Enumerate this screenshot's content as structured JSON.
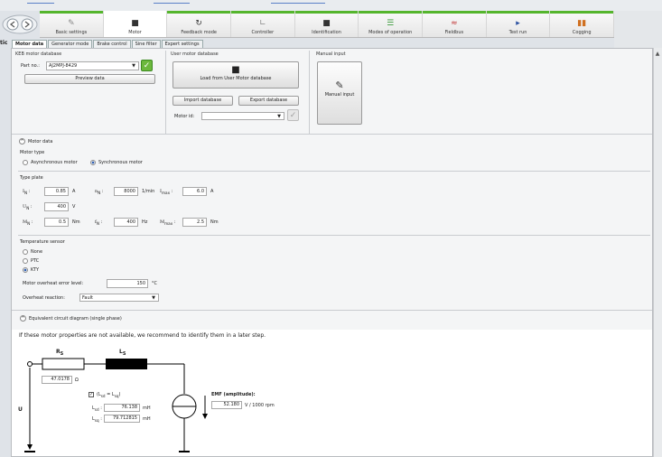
{
  "ribbon": {
    "tabs": [
      {
        "label": "Basic settings",
        "icon": "wrench-icon",
        "active": false
      },
      {
        "label": "Motor",
        "icon": "motor-icon",
        "active": true
      },
      {
        "label": "Feedback mode",
        "icon": "feedback-icon",
        "active": false
      },
      {
        "label": "Controller",
        "icon": "controller-icon",
        "active": false
      },
      {
        "label": "Identification",
        "icon": "identification-icon",
        "active": false
      },
      {
        "label": "Modes of operation",
        "icon": "modes-icon",
        "active": false
      },
      {
        "label": "Fieldbus",
        "icon": "fieldbus-icon",
        "active": false
      },
      {
        "label": "Test run",
        "icon": "play-icon",
        "active": false
      },
      {
        "label": "Cogging",
        "icon": "bar-chart-icon",
        "active": false
      }
    ],
    "accent": "#55b52d"
  },
  "subtabs": [
    {
      "label": "Motor data",
      "active": true
    },
    {
      "label": "Generator mode",
      "active": false
    },
    {
      "label": "Brake control",
      "active": false
    },
    {
      "label": "Sine filter",
      "active": false
    },
    {
      "label": "Expert settings",
      "active": false
    }
  ],
  "side_label": "tic",
  "keb_db": {
    "title": "KEB motor database",
    "partno_label": "Part no.:",
    "partno_value": "AJ2MPJ-8429",
    "preview_label": "Preview data"
  },
  "user_db": {
    "title": "User motor database",
    "load_label": "Load from User Motor database",
    "import_label": "Import database",
    "export_label": "Export database",
    "motorid_label": "Motor id:"
  },
  "manual": {
    "title": "Manual input",
    "button_label": "Manual input"
  },
  "motor_data": {
    "header": "Motor data",
    "type_title": "Motor type",
    "async_label": "Asynchronous motor",
    "sync_label": "Synchronous motor"
  },
  "type_plate": {
    "title": "Type plate",
    "in_label": "I",
    "in_sub": "N",
    "in_value": "0.85",
    "in_unit": "A",
    "nn_label": "n",
    "nn_sub": "N",
    "nn_value": "8000",
    "nn_unit": "1/min",
    "imax_label": "I",
    "imax_sub": "max",
    "imax_value": "6.0",
    "imax_unit": "A",
    "un_label": "U",
    "un_sub": "N",
    "un_value": "400",
    "un_unit": "V",
    "mn_label": "M",
    "mn_sub": "N",
    "mn_value": "0.5",
    "mn_unit": "Nm",
    "fn_label": "f",
    "fn_sub": "N",
    "fn_value": "400",
    "fn_unit": "Hz",
    "mmax_label": "M",
    "mmax_sub": "max",
    "mmax_value": "2.5",
    "mmax_unit": "Nm"
  },
  "temp_sensor": {
    "title": "Temperature sensor",
    "options": [
      "None",
      "PTC",
      "KTY"
    ],
    "selected": "KTY",
    "overheat_error_label": "Motor overheat error level:",
    "overheat_error_value": "150",
    "overheat_error_unit": "°C",
    "overheat_reaction_label": "Overheat reaction:",
    "overheat_reaction_value": "Fault"
  },
  "ecd": {
    "header": "Equivalent circuit diagram (single phase)",
    "note": "If these motor properties are not available, we recommend to identify them in a later step.",
    "rs_label": "R",
    "rs_sub": "S",
    "ls_label": "L",
    "ls_sub": "S",
    "rs_value": "47.0178",
    "rs_unit": "Ω",
    "lsq_check_label": "(L",
    "lsq_check_sub1": "sd",
    "lsq_check_mid": " = L",
    "lsq_check_sub2": "sq",
    "lsq_check_end": ")",
    "lsd_label": "L",
    "lsd_sub": "sd",
    "lsd_value": "76.138",
    "lsd_unit": "mH",
    "lsq_label": "L",
    "lsq_sub": "sq",
    "lsq_value": "79.712815",
    "lsq_unit": "mH",
    "u_label": "U",
    "emf_label": "EMF (amplitude):",
    "emf_value": "52.180",
    "emf_unit": "V / 1000 rpm"
  }
}
